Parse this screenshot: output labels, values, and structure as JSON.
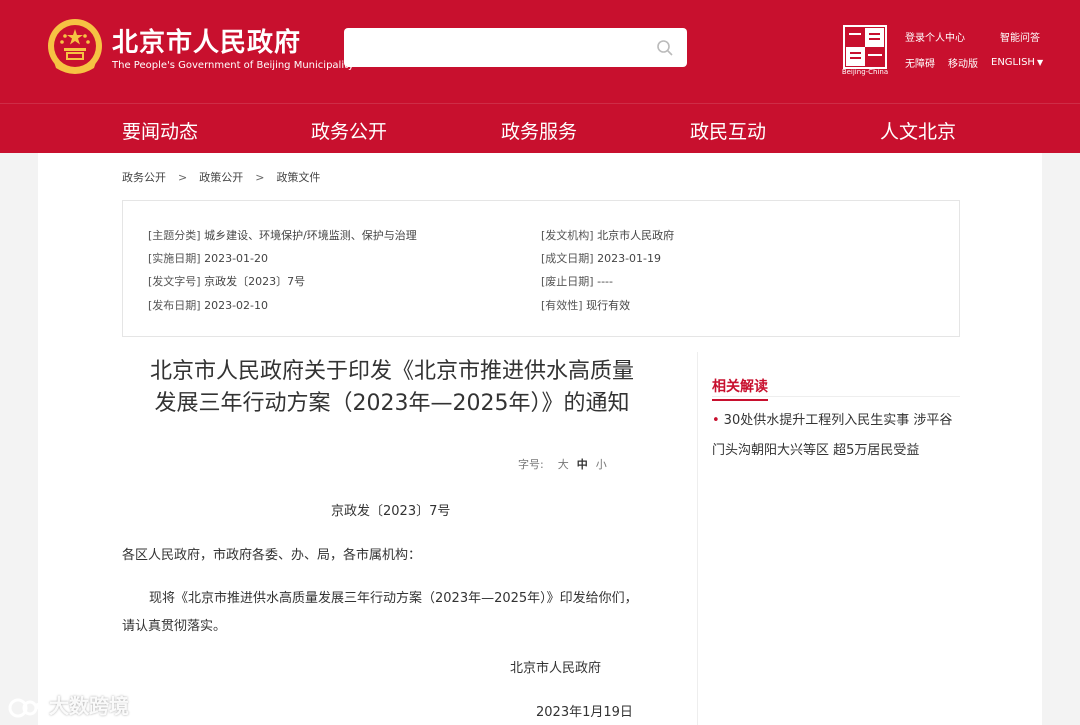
{
  "header": {
    "site_title": "北京市人民政府",
    "site_subtitle": "The People's Government of Beijing Municipality",
    "search_placeholder": "",
    "logo_caption": "Beijing-China",
    "links": {
      "login": "登录个人中心",
      "smart_qa": "智能问答",
      "accessibility": "无障碍",
      "mobile": "移动版",
      "english": "ENGLISH"
    }
  },
  "nav": {
    "items": [
      "要闻动态",
      "政务公开",
      "政务服务",
      "政民互动",
      "人文北京"
    ]
  },
  "breadcrumb": {
    "items": [
      "政务公开",
      "政策公开",
      "政策文件"
    ],
    "separator": ">"
  },
  "meta": {
    "left": [
      {
        "key": "[主题分类]",
        "value": "城乡建设、环境保护/环境监测、保护与治理"
      },
      {
        "key": "[实施日期]",
        "value": "2023-01-20"
      },
      {
        "key": "[发文字号]",
        "value": "京政发〔2023〕7号"
      },
      {
        "key": "[发布日期]",
        "value": "2023-02-10"
      }
    ],
    "right": [
      {
        "key": "[发文机构]",
        "value": "北京市人民政府"
      },
      {
        "key": "[成文日期]",
        "value": "2023-01-19"
      },
      {
        "key": "[废止日期]",
        "value": "----"
      },
      {
        "key": "[有效性]",
        "value": "现行有效"
      }
    ]
  },
  "article": {
    "title_line1": "北京市人民政府关于印发《北京市推进供水高质量",
    "title_line2": "发展三年行动方案（2023年—2025年）》的通知",
    "font_size_label": "字号:",
    "font_sizes": {
      "large": "大",
      "medium": "中",
      "small": "小"
    },
    "doc_number": "京政发〔2023〕7号",
    "salutation": "各区人民政府，市政府各委、办、局，各市属机构：",
    "body_line1": "现将《北京市推进供水高质量发展三年行动方案（2023年—2025年）》印发给你们，",
    "body_line2": "请认真贯彻落实。",
    "signature": "北京市人民政府",
    "date": "2023年1月19日"
  },
  "sidebar": {
    "title": "相关解读",
    "bullet": "•",
    "link_text": "30处供水提升工程列入民生实事 涉平谷门头沟朝阳大兴等区 超5万居民受益"
  },
  "watermark": {
    "text": "大数跨境"
  },
  "colors": {
    "brand_red": "#c8102e",
    "gold": "#f6c343"
  }
}
